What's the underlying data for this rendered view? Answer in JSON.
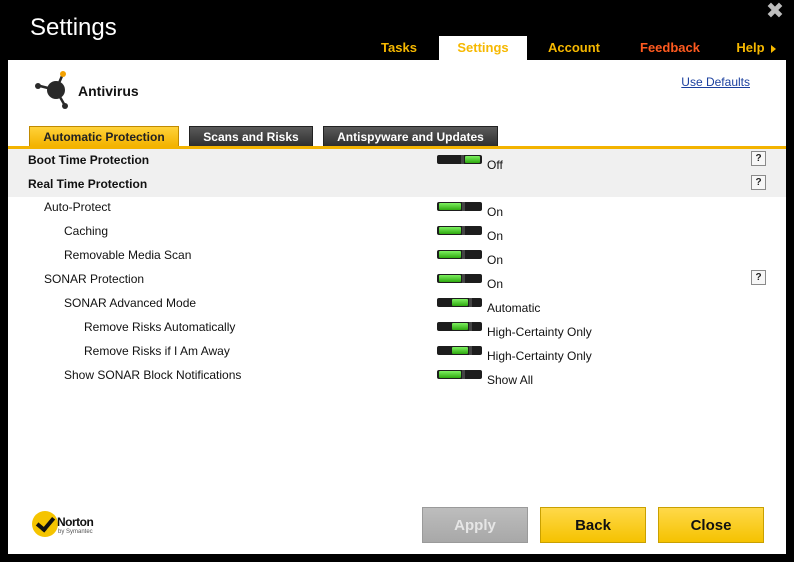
{
  "window": {
    "title": "Settings"
  },
  "nav": {
    "tasks": "Tasks",
    "settings": "Settings",
    "account": "Account",
    "feedback": "Feedback",
    "help": "Help"
  },
  "header": {
    "title": "Antivirus",
    "use_defaults": "Use Defaults"
  },
  "tabs": {
    "automatic_protection": "Automatic Protection",
    "scans_and_risks": "Scans and Risks",
    "antispyware": "Antispyware and Updates"
  },
  "rows": [
    {
      "label": "Boot Time Protection",
      "value": "Off",
      "level": 0,
      "section": true,
      "toggle": "off",
      "help": true
    },
    {
      "label": "Real Time Protection",
      "value": "",
      "level": 0,
      "section": true,
      "toggle": "none",
      "help": true
    },
    {
      "label": "Auto-Protect",
      "value": "On",
      "level": 1,
      "section": false,
      "toggle": "on",
      "help": false
    },
    {
      "label": "Caching",
      "value": "On",
      "level": 2,
      "section": false,
      "toggle": "on",
      "help": false
    },
    {
      "label": "Removable Media Scan",
      "value": "On",
      "level": 2,
      "section": false,
      "toggle": "on",
      "help": false
    },
    {
      "label": "SONAR Protection",
      "value": "On",
      "level": 1,
      "section": false,
      "toggle": "on",
      "help": true
    },
    {
      "label": "SONAR Advanced Mode",
      "value": "Automatic",
      "level": 2,
      "section": false,
      "toggle": "mid",
      "help": false
    },
    {
      "label": "Remove Risks Automatically",
      "value": "High-Certainty Only",
      "level": 3,
      "section": false,
      "toggle": "mid",
      "help": false
    },
    {
      "label": "Remove Risks if I Am Away",
      "value": "High-Certainty Only",
      "level": 3,
      "section": false,
      "toggle": "mid",
      "help": false
    },
    {
      "label": "Show SONAR Block Notifications",
      "value": "Show All",
      "level": 2,
      "section": false,
      "toggle": "on",
      "help": false
    }
  ],
  "help_glyph": "?",
  "footer": {
    "logo_name": "Norton",
    "logo_sub": "by Symantec",
    "apply": "Apply",
    "back": "Back",
    "close": "Close"
  },
  "colors": {
    "accent_yellow": "#f6b800",
    "feedback_orange": "#ff5a1f",
    "toggle_green": "#2ea80f",
    "link_blue": "#1a3f9e"
  }
}
